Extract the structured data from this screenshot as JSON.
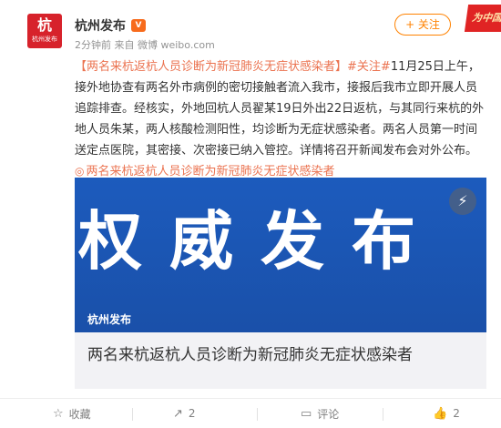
{
  "header": {
    "avatar_mark": "杭",
    "avatar_text": "杭州发布",
    "author": "杭州发布",
    "vip_badge": "V",
    "meta": "2分钟前 来自 微博 weibo.com",
    "follow_label": "+ 关注",
    "banner_text": "为中国加油"
  },
  "post": {
    "title_link": "【两名来杭返杭人员诊断为新冠肺炎无症状感染者】",
    "topic_link": "#关注#",
    "body": "11月25日上午，接外地协查有两名外市病例的密切接触者流入我市，接报后我市立即开展人员追踪排查。经核实，外地回杭人员翟某19日外出22日返杭，与其同行来杭的外地人员朱某，两人核酸检测阳性，均诊断为无症状感染者。两名人员第一时间送定点医院，其密接、次密接已纳入管控。详情将召开新闻发布会对外公布。",
    "topic_icon": "◎",
    "trailing_link": "两名来杭返杭人员诊断为新冠肺炎无症状感染者"
  },
  "card": {
    "big_text": "权威发布",
    "label": "杭州发布",
    "play_icon": "⚡",
    "title": "两名来杭返杭人员诊断为新冠肺炎无症状感染者",
    "colors": {
      "image_bg": "#1c5bbd"
    }
  },
  "footer": {
    "fav_icon": "☆",
    "fav_label": "收藏",
    "share_icon": "↗",
    "share_count": "2",
    "comment_icon": "▭",
    "comment_label": "评论",
    "like_icon": "👍",
    "like_count": "2"
  },
  "colors": {
    "link": "#eb7350",
    "follow": "#ff8200",
    "avatar_bg": "#d7222b"
  }
}
